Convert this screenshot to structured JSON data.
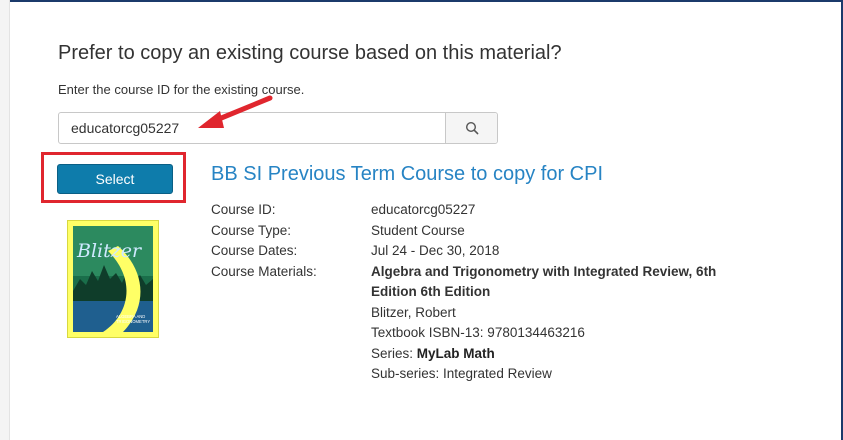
{
  "copy_section": {
    "heading": "Prefer to copy an existing course based on this material?",
    "instruction": "Enter the course ID for the existing course."
  },
  "search": {
    "value": "educatorcg05227",
    "icon": "search-icon"
  },
  "annotations": {
    "arrow_color": "#e0262e",
    "highlight_color": "#e0262e"
  },
  "result": {
    "select_label": "Select",
    "title": "BB SI Previous Term Course to copy for CPI",
    "fields": {
      "course_id_label": "Course ID:",
      "course_id": "educatorcg05227",
      "course_type_label": "Course Type:",
      "course_type": "Student Course",
      "course_dates_label": "Course Dates:",
      "course_dates": "Jul 24 - Dec 30, 2018",
      "course_materials_label": "Course Materials:"
    },
    "material": {
      "title_line1": "Algebra and Trigonometry with Integrated Review, 6th",
      "title_line2": "Edition 6th Edition",
      "author": "Blitzer, Robert",
      "isbn": "Textbook ISBN-13: 9780134463216",
      "series_label": "Series: ",
      "series_name": "MyLab Math",
      "subseries": "Sub-series: Integrated Review"
    },
    "cover": {
      "brand": "Blitzer",
      "caption_line1": "ALGEBRA AND",
      "caption_line2": "TRIGONOMETRY",
      "bg_color": "#ffff66",
      "panel_color": "#1a6e4a"
    }
  },
  "colors": {
    "primary_button": "#0e7cab",
    "link": "#2784c4",
    "frame_border": "#1b3a6b"
  }
}
